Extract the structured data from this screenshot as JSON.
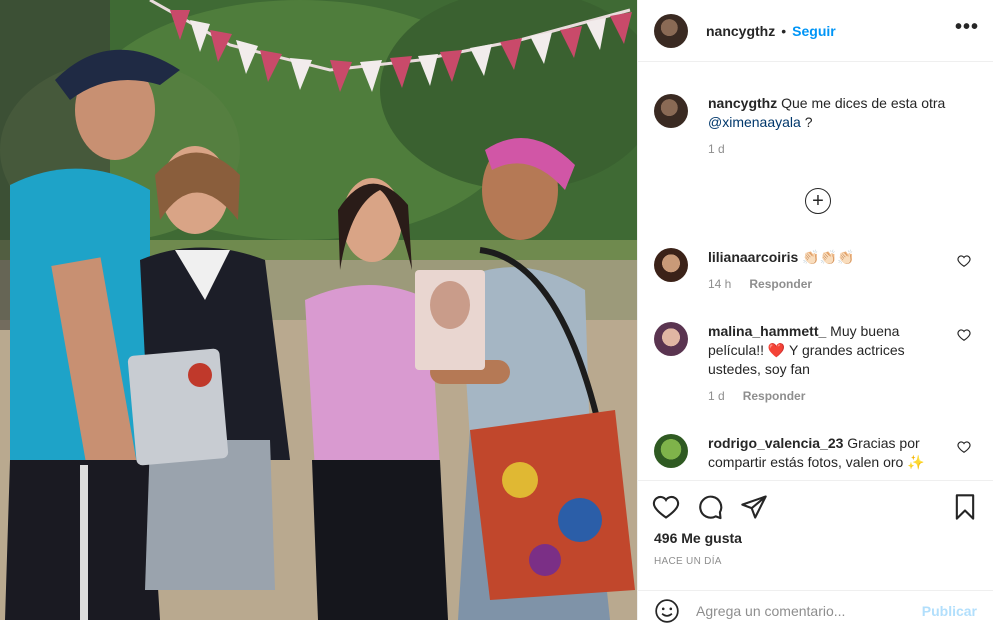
{
  "post": {
    "author": "nancygthz",
    "follow_label": "Seguir",
    "dot": "•",
    "more_label": "•••",
    "caption": {
      "user": "nancygthz",
      "text": "Que me dices de esta otra",
      "mention": "@ximenaayala",
      "tail": " ?",
      "time": "1 d"
    },
    "load_more_label": "+"
  },
  "comments": [
    {
      "user": "lilianaarcoiris",
      "text": "👏🏻👏🏻👏🏻",
      "time": "14 h",
      "reply": "Responder"
    },
    {
      "user": "malina_hammett_",
      "text": "Muy buena película!! ❤️ Y grandes actrices ustedes, soy fan",
      "time": "1 d",
      "reply": "Responder"
    },
    {
      "user": "rodrigo_valencia_23",
      "text": "Gracias por compartir estás fotos, valen oro ✨",
      "time": "",
      "reply": ""
    }
  ],
  "stats": {
    "likes": "496 Me gusta",
    "ago": "HACE UN DÍA"
  },
  "add_comment": {
    "placeholder": "Agrega un comentario...",
    "publish": "Publicar"
  },
  "colors": {
    "accent": "#0095f6",
    "publish_disabled": "#b2dffc",
    "muted": "#8e8e8e"
  },
  "icons": [
    "heart-icon",
    "comment-icon",
    "share-icon",
    "bookmark-icon",
    "emoji-icon",
    "more-icon",
    "plus-circle-icon"
  ]
}
